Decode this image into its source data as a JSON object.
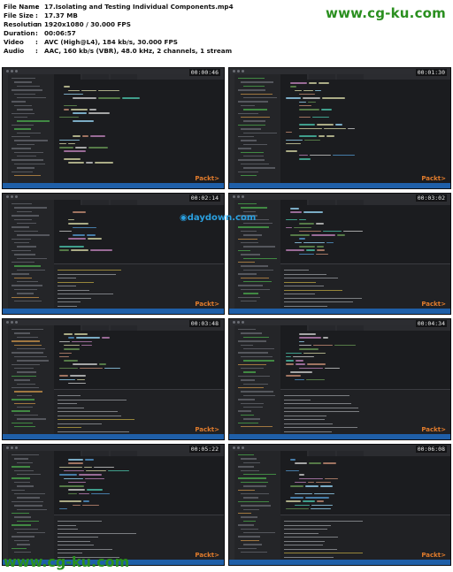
{
  "meta": {
    "rows": [
      {
        "key": "File Name",
        "value": "17.Isolating and Testing  Individual Components.mp4"
      },
      {
        "key": "File Size",
        "value": "17.37 MB"
      },
      {
        "key": "Resolution",
        "value": "1920x1080 / 30.000 FPS"
      },
      {
        "key": "Duration",
        "value": "00:06:57"
      },
      {
        "key": "Video",
        "value": "AVC (High@L4), 184 kb/s, 30.000 FPS"
      },
      {
        "key": "Audio",
        "value": "AAC, 160 kb/s (VBR), 48.0 kHz, 2 channels, 1 stream"
      }
    ],
    "separator": ":"
  },
  "watermarks": {
    "top": "www.cg-ku.com",
    "middle": "daydown.com",
    "bottom": "www.cg-ku.com",
    "publisher": "Packt>"
  },
  "thumbnails": [
    {
      "timestamp": "00:00:46"
    },
    {
      "timestamp": "00:01:30"
    },
    {
      "timestamp": "00:02:14"
    },
    {
      "timestamp": "00:03:02"
    },
    {
      "timestamp": "00:03:48"
    },
    {
      "timestamp": "00:04:34"
    },
    {
      "timestamp": "00:05:22"
    },
    {
      "timestamp": "00:06:08"
    }
  ],
  "colors": {
    "watermark_green": "#2a8f1f",
    "watermark_blue": "#2aa0e0",
    "publisher_orange": "#e07b2c",
    "editor_bg": "#1b1c1f",
    "statusbar": "#1f5fa8"
  }
}
